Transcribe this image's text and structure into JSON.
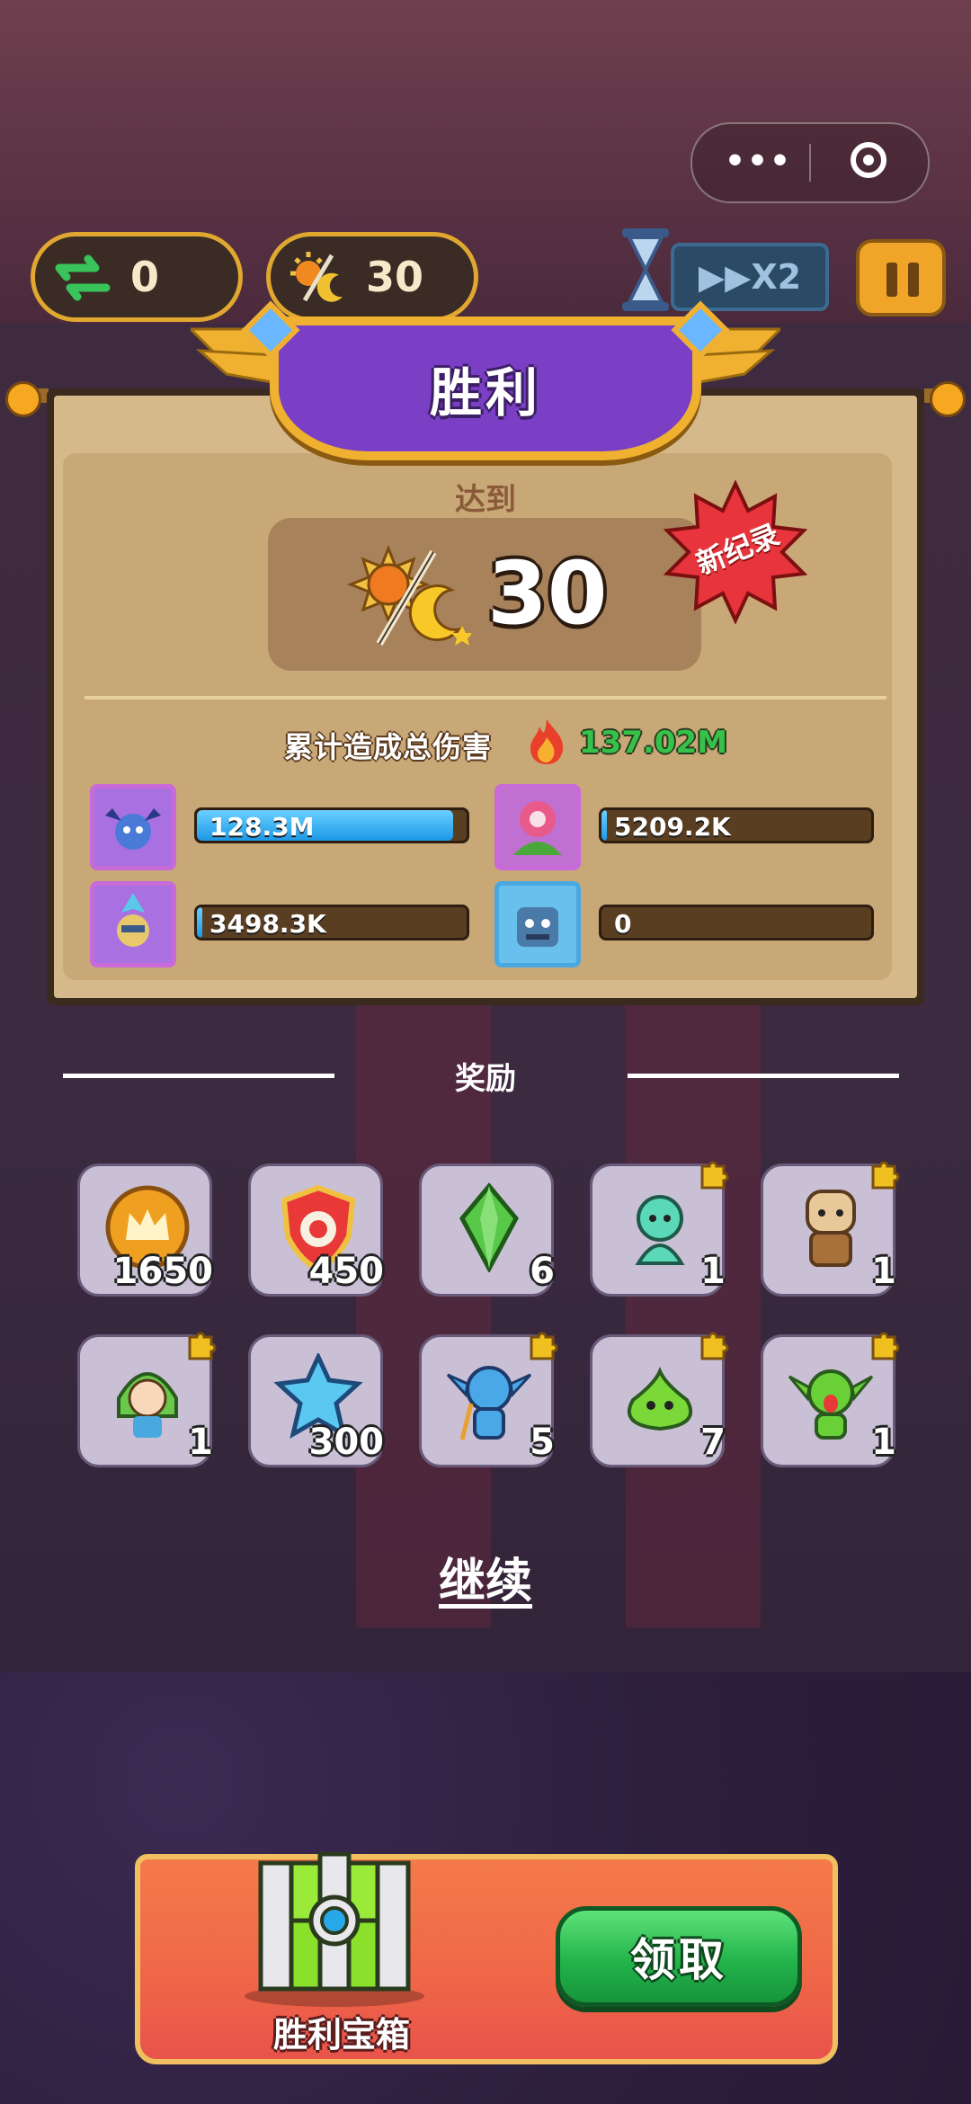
{
  "hud": {
    "swap_count": "0",
    "round_count": "30",
    "speed_label": "X2"
  },
  "result": {
    "title": "胜利",
    "reach_label": "达到",
    "round_value": "30",
    "record_badge": "新纪录",
    "damage_label": "累计造成总伤害",
    "damage_total": "137.02M"
  },
  "heroes": [
    {
      "name_icon": "demon-hero-icon",
      "damage": "128.3M",
      "fill": 0.95,
      "frame": "#c86ad8"
    },
    {
      "name_icon": "flower-hero-icon",
      "damage": "5209.2K",
      "fill": 0.02,
      "frame": "#c86ad8"
    },
    {
      "name_icon": "ice-knight-hero-icon",
      "damage": "3498.3K",
      "fill": 0.02,
      "frame": "#c86ad8"
    },
    {
      "name_icon": "stone-golem-hero-icon",
      "damage": "0",
      "fill": 0,
      "frame": "#4aa8e0"
    }
  ],
  "rewards": {
    "label": "奖励",
    "items": [
      {
        "icon": "crown-coin-icon",
        "count": "1650"
      },
      {
        "icon": "shield-emblem-icon",
        "count": "450"
      },
      {
        "icon": "green-crystal-icon",
        "count": "6"
      },
      {
        "icon": "mermaid-hero-piece-icon",
        "count": "1"
      },
      {
        "icon": "golem-hero-piece-icon",
        "count": "1"
      },
      {
        "icon": "elf-girl-hero-piece-icon",
        "count": "1"
      },
      {
        "icon": "blue-gem-icon",
        "count": "300"
      },
      {
        "icon": "goblin-hero-piece-icon",
        "count": "5"
      },
      {
        "icon": "slime-hero-piece-icon",
        "count": "7"
      },
      {
        "icon": "green-goblin-hero-piece-icon",
        "count": "1"
      }
    ]
  },
  "continue_label": "继续",
  "chest": {
    "label": "胜利宝箱",
    "claim_label": "领取"
  }
}
